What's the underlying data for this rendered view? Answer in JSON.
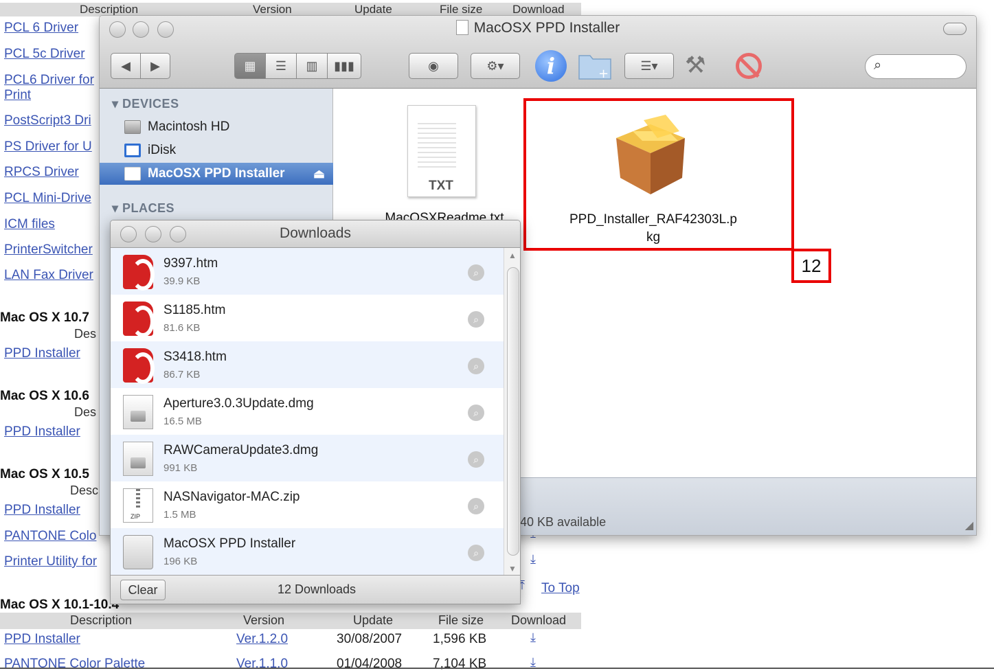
{
  "bg_page": {
    "header": {
      "description": "Description",
      "version": "Version",
      "update": "Update",
      "file_size": "File size",
      "download": "Download"
    },
    "links": [
      "PCL 6 Driver",
      "PCL 5c Driver",
      "PCL6 Driver for",
      "Print",
      "PostScript3 Dri",
      "PS Driver for U",
      "RPCS Driver",
      "PCL Mini-Drive",
      "ICM files",
      "PrinterSwitcher",
      "LAN Fax Driver"
    ],
    "sections": [
      {
        "title": "Mac OS X 10.7",
        "desc": "Des",
        "link": "PPD Installer"
      },
      {
        "title": "Mac OS X 10.6",
        "desc": "Des",
        "link": "PPD Installer"
      },
      {
        "title": "Mac OS X 10.5",
        "desc": "Desc",
        "link": "PPD Installer"
      }
    ],
    "extra_links": [
      "PANTONE Colo",
      "Printer Utility for"
    ],
    "last_section_title": "Mac OS X 10.1-10.4",
    "to_top": "To Top",
    "table": {
      "headers": [
        "Description",
        "Version",
        "Update",
        "File size",
        "Download"
      ],
      "rows": [
        {
          "description": "PPD Installer",
          "version": "Ver.1.2.0",
          "update": "30/08/2007",
          "size": "1,596 KB"
        },
        {
          "description": "PANTONE Color Palette",
          "version": "Ver.1.1.0",
          "update": "01/04/2008",
          "size": "7,104 KB"
        }
      ]
    }
  },
  "finder": {
    "title": "MacOSX PPD Installer",
    "sidebar": {
      "devices_label": "DEVICES",
      "places_label": "PLACES",
      "devices": [
        "Macintosh HD",
        "iDisk",
        "MacOSX PPD Installer"
      ]
    },
    "files": [
      {
        "name": "MacOSXReadme.txt",
        "ext": "TXT"
      },
      {
        "name_line1": "PPD_Installer_RAF42303L.p",
        "name_line2": "kg"
      }
    ],
    "status": "40 KB available"
  },
  "annotation": {
    "badge": "12"
  },
  "downloads": {
    "title": "Downloads",
    "items": [
      {
        "name": "9397.htm",
        "size": "39.9 KB",
        "icon": "opera-icon"
      },
      {
        "name": "S1185.htm",
        "size": "81.6 KB",
        "icon": "opera-icon"
      },
      {
        "name": "S3418.htm",
        "size": "86.7 KB",
        "icon": "opera-icon"
      },
      {
        "name": "Aperture3.0.3Update.dmg",
        "size": "16.5 MB",
        "icon": "dmg-icon"
      },
      {
        "name": "RAWCameraUpdate3.dmg",
        "size": "991 KB",
        "icon": "dmg-icon"
      },
      {
        "name": "NASNavigator-MAC.zip",
        "size": "1.5 MB",
        "icon": "zip-icon"
      },
      {
        "name": "MacOSX PPD Installer",
        "size": "196 KB",
        "icon": "disk-icon"
      }
    ],
    "clear_label": "Clear",
    "count_label": "12 Downloads",
    "zip_badge": "ZIP"
  }
}
